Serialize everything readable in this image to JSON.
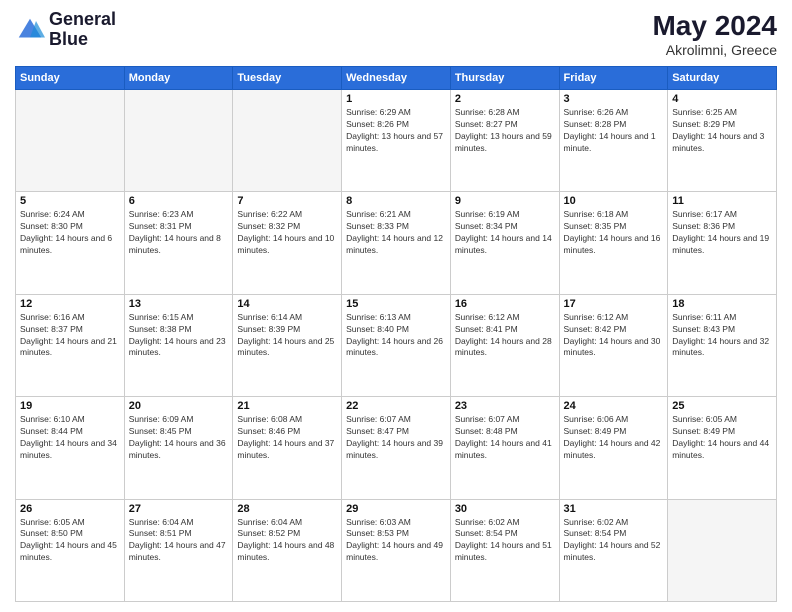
{
  "header": {
    "logo_line1": "General",
    "logo_line2": "Blue",
    "month_year": "May 2024",
    "location": "Akrolimni, Greece"
  },
  "days_of_week": [
    "Sunday",
    "Monday",
    "Tuesday",
    "Wednesday",
    "Thursday",
    "Friday",
    "Saturday"
  ],
  "weeks": [
    [
      {
        "num": "",
        "sunrise": "",
        "sunset": "",
        "daylight": ""
      },
      {
        "num": "",
        "sunrise": "",
        "sunset": "",
        "daylight": ""
      },
      {
        "num": "",
        "sunrise": "",
        "sunset": "",
        "daylight": ""
      },
      {
        "num": "1",
        "sunrise": "Sunrise: 6:29 AM",
        "sunset": "Sunset: 8:26 PM",
        "daylight": "Daylight: 13 hours and 57 minutes."
      },
      {
        "num": "2",
        "sunrise": "Sunrise: 6:28 AM",
        "sunset": "Sunset: 8:27 PM",
        "daylight": "Daylight: 13 hours and 59 minutes."
      },
      {
        "num": "3",
        "sunrise": "Sunrise: 6:26 AM",
        "sunset": "Sunset: 8:28 PM",
        "daylight": "Daylight: 14 hours and 1 minute."
      },
      {
        "num": "4",
        "sunrise": "Sunrise: 6:25 AM",
        "sunset": "Sunset: 8:29 PM",
        "daylight": "Daylight: 14 hours and 3 minutes."
      }
    ],
    [
      {
        "num": "5",
        "sunrise": "Sunrise: 6:24 AM",
        "sunset": "Sunset: 8:30 PM",
        "daylight": "Daylight: 14 hours and 6 minutes."
      },
      {
        "num": "6",
        "sunrise": "Sunrise: 6:23 AM",
        "sunset": "Sunset: 8:31 PM",
        "daylight": "Daylight: 14 hours and 8 minutes."
      },
      {
        "num": "7",
        "sunrise": "Sunrise: 6:22 AM",
        "sunset": "Sunset: 8:32 PM",
        "daylight": "Daylight: 14 hours and 10 minutes."
      },
      {
        "num": "8",
        "sunrise": "Sunrise: 6:21 AM",
        "sunset": "Sunset: 8:33 PM",
        "daylight": "Daylight: 14 hours and 12 minutes."
      },
      {
        "num": "9",
        "sunrise": "Sunrise: 6:19 AM",
        "sunset": "Sunset: 8:34 PM",
        "daylight": "Daylight: 14 hours and 14 minutes."
      },
      {
        "num": "10",
        "sunrise": "Sunrise: 6:18 AM",
        "sunset": "Sunset: 8:35 PM",
        "daylight": "Daylight: 14 hours and 16 minutes."
      },
      {
        "num": "11",
        "sunrise": "Sunrise: 6:17 AM",
        "sunset": "Sunset: 8:36 PM",
        "daylight": "Daylight: 14 hours and 19 minutes."
      }
    ],
    [
      {
        "num": "12",
        "sunrise": "Sunrise: 6:16 AM",
        "sunset": "Sunset: 8:37 PM",
        "daylight": "Daylight: 14 hours and 21 minutes."
      },
      {
        "num": "13",
        "sunrise": "Sunrise: 6:15 AM",
        "sunset": "Sunset: 8:38 PM",
        "daylight": "Daylight: 14 hours and 23 minutes."
      },
      {
        "num": "14",
        "sunrise": "Sunrise: 6:14 AM",
        "sunset": "Sunset: 8:39 PM",
        "daylight": "Daylight: 14 hours and 25 minutes."
      },
      {
        "num": "15",
        "sunrise": "Sunrise: 6:13 AM",
        "sunset": "Sunset: 8:40 PM",
        "daylight": "Daylight: 14 hours and 26 minutes."
      },
      {
        "num": "16",
        "sunrise": "Sunrise: 6:12 AM",
        "sunset": "Sunset: 8:41 PM",
        "daylight": "Daylight: 14 hours and 28 minutes."
      },
      {
        "num": "17",
        "sunrise": "Sunrise: 6:12 AM",
        "sunset": "Sunset: 8:42 PM",
        "daylight": "Daylight: 14 hours and 30 minutes."
      },
      {
        "num": "18",
        "sunrise": "Sunrise: 6:11 AM",
        "sunset": "Sunset: 8:43 PM",
        "daylight": "Daylight: 14 hours and 32 minutes."
      }
    ],
    [
      {
        "num": "19",
        "sunrise": "Sunrise: 6:10 AM",
        "sunset": "Sunset: 8:44 PM",
        "daylight": "Daylight: 14 hours and 34 minutes."
      },
      {
        "num": "20",
        "sunrise": "Sunrise: 6:09 AM",
        "sunset": "Sunset: 8:45 PM",
        "daylight": "Daylight: 14 hours and 36 minutes."
      },
      {
        "num": "21",
        "sunrise": "Sunrise: 6:08 AM",
        "sunset": "Sunset: 8:46 PM",
        "daylight": "Daylight: 14 hours and 37 minutes."
      },
      {
        "num": "22",
        "sunrise": "Sunrise: 6:07 AM",
        "sunset": "Sunset: 8:47 PM",
        "daylight": "Daylight: 14 hours and 39 minutes."
      },
      {
        "num": "23",
        "sunrise": "Sunrise: 6:07 AM",
        "sunset": "Sunset: 8:48 PM",
        "daylight": "Daylight: 14 hours and 41 minutes."
      },
      {
        "num": "24",
        "sunrise": "Sunrise: 6:06 AM",
        "sunset": "Sunset: 8:49 PM",
        "daylight": "Daylight: 14 hours and 42 minutes."
      },
      {
        "num": "25",
        "sunrise": "Sunrise: 6:05 AM",
        "sunset": "Sunset: 8:49 PM",
        "daylight": "Daylight: 14 hours and 44 minutes."
      }
    ],
    [
      {
        "num": "26",
        "sunrise": "Sunrise: 6:05 AM",
        "sunset": "Sunset: 8:50 PM",
        "daylight": "Daylight: 14 hours and 45 minutes."
      },
      {
        "num": "27",
        "sunrise": "Sunrise: 6:04 AM",
        "sunset": "Sunset: 8:51 PM",
        "daylight": "Daylight: 14 hours and 47 minutes."
      },
      {
        "num": "28",
        "sunrise": "Sunrise: 6:04 AM",
        "sunset": "Sunset: 8:52 PM",
        "daylight": "Daylight: 14 hours and 48 minutes."
      },
      {
        "num": "29",
        "sunrise": "Sunrise: 6:03 AM",
        "sunset": "Sunset: 8:53 PM",
        "daylight": "Daylight: 14 hours and 49 minutes."
      },
      {
        "num": "30",
        "sunrise": "Sunrise: 6:02 AM",
        "sunset": "Sunset: 8:54 PM",
        "daylight": "Daylight: 14 hours and 51 minutes."
      },
      {
        "num": "31",
        "sunrise": "Sunrise: 6:02 AM",
        "sunset": "Sunset: 8:54 PM",
        "daylight": "Daylight: 14 hours and 52 minutes."
      },
      {
        "num": "",
        "sunrise": "",
        "sunset": "",
        "daylight": ""
      }
    ]
  ]
}
